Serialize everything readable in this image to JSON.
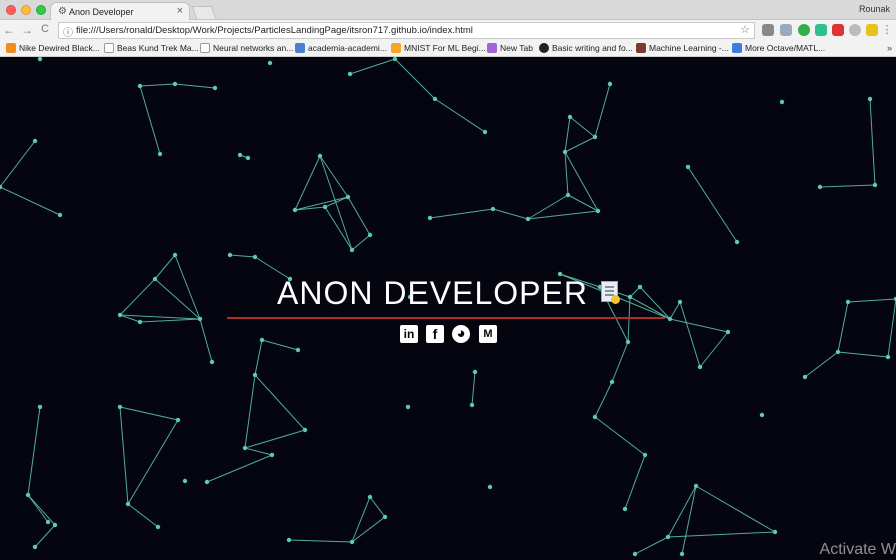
{
  "window": {
    "tab_title": "Anon Developer",
    "tab_close": "×",
    "profile_name": "Rounak"
  },
  "toolbar": {
    "url": "file:///Users/ronald/Desktop/Work/Projects/ParticlesLandingPage/itsron717.github.io/index.html",
    "back_glyph": "←",
    "forward_glyph": "→",
    "reload_glyph": "C",
    "info_glyph": "ⓘ",
    "star_glyph": "☆",
    "menu_glyph": "⋮"
  },
  "bookmarks": [
    {
      "label": "Nike Dewired Black...",
      "icon_color": "#f28c1a"
    },
    {
      "label": "Beas Kund Trek Ma...",
      "icon_color": "#ffffff"
    },
    {
      "label": "Neural networks an...",
      "icon_color": "#ffffff"
    },
    {
      "label": "academia-academi...",
      "icon_color": "#4a7fd4"
    },
    {
      "label": "MNIST For ML Begi...",
      "icon_color": "#f5a623"
    },
    {
      "label": "New Tab",
      "icon_color": "#a066d3"
    },
    {
      "label": "Basic writing and fo...",
      "icon_color": "#222222"
    },
    {
      "label": "Machine Learning -...",
      "icon_color": "#7a3b2e"
    },
    {
      "label": "More Octave/MATL...",
      "icon_color": "#3d7be0"
    }
  ],
  "bookmarks_more": "»",
  "page": {
    "heading": "ANON DEVELOPER",
    "social": [
      {
        "name": "linkedin-icon",
        "glyph": "in"
      },
      {
        "name": "facebook-icon",
        "glyph": "f"
      },
      {
        "name": "github-icon",
        "glyph": "◕"
      },
      {
        "name": "medium-icon",
        "glyph": "M"
      }
    ],
    "accent_line_color": "#b02d2d",
    "particle_color": "#5fc9b4",
    "background_color": "#05050f"
  },
  "watermark": "Activate W"
}
